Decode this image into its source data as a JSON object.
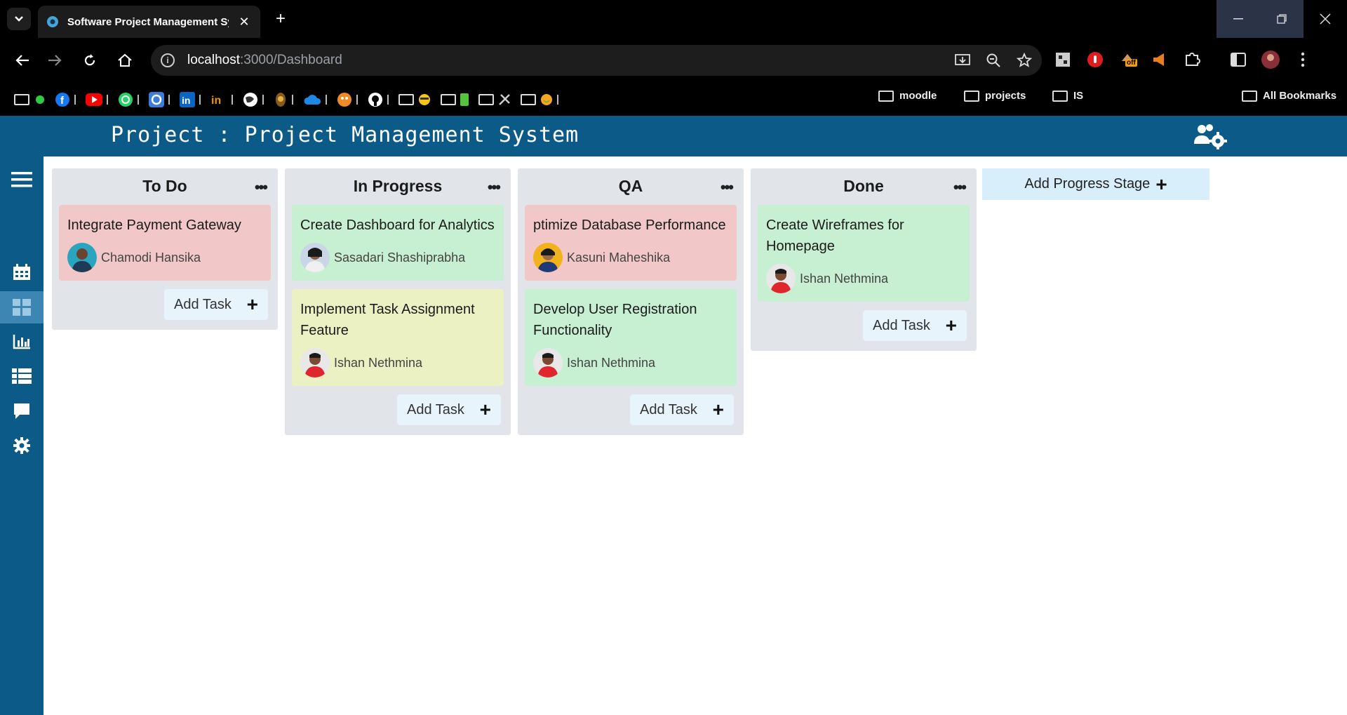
{
  "browser": {
    "tab_title": "Software Project Management Sy",
    "url_host": "localhost",
    "url_path": ":3000/Dashboard",
    "bookmark_folders": [
      "moodle",
      "projects",
      "IS"
    ],
    "all_bookmarks": "All Bookmarks",
    "extension_badge": "off"
  },
  "app": {
    "project_title": "Project : Project Management System",
    "add_stage_label": "Add Progress Stage",
    "add_task_label": "Add Task"
  },
  "columns": [
    {
      "title": "To Do",
      "cards": [
        {
          "title": "Integrate Payment Gateway",
          "assignee": "Chamodi Hansika",
          "color": "#f1c7c8"
        }
      ]
    },
    {
      "title": "In Progress",
      "cards": [
        {
          "title": "Create Dashboard for Analytics",
          "assignee": "Sasadari Shashiprabha",
          "color": "#c7efd2"
        },
        {
          "title": "Implement Task Assignment Feature",
          "assignee": "Ishan Nethmina",
          "color": "#ecf1c4"
        }
      ]
    },
    {
      "title": "QA",
      "cards": [
        {
          "title": "ptimize Database Performance",
          "assignee": "Kasuni Maheshika",
          "color": "#f1c7c8"
        },
        {
          "title": "Develop User Registration Functionality",
          "assignee": "Ishan Nethmina",
          "color": "#c7efd2"
        }
      ]
    },
    {
      "title": "Done",
      "cards": [
        {
          "title": "Create Wireframes for Homepage",
          "assignee": "Ishan Nethmina",
          "color": "#c7efd2"
        }
      ]
    }
  ],
  "colors": {
    "header": "#0c5a87",
    "sidebar_active": "#3d86b3",
    "column_bg": "#e1e4e8"
  }
}
